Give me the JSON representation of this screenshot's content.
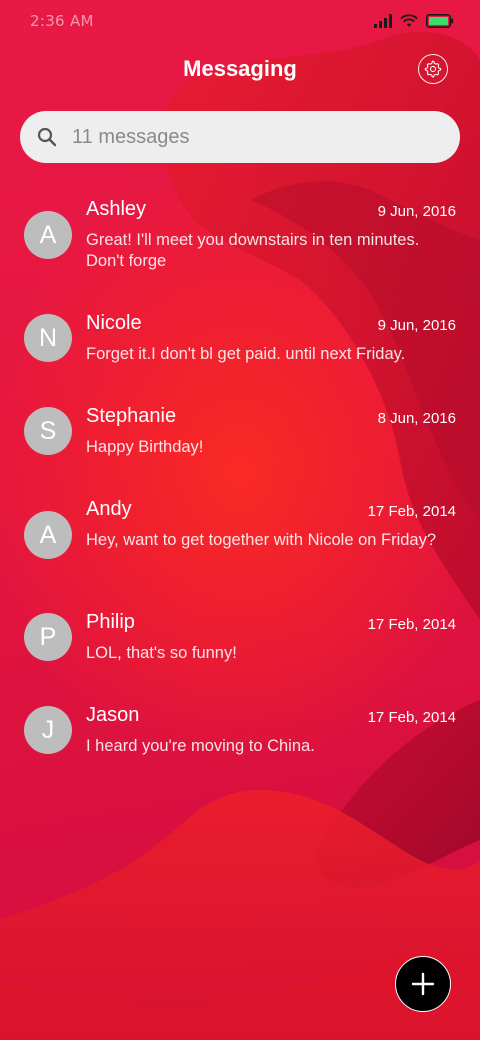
{
  "status_bar": {
    "time": "2:36 AM",
    "icons": [
      "signal-icon",
      "wifi-icon",
      "battery-icon"
    ]
  },
  "header": {
    "title": "Messaging",
    "settings_icon": "gear-icon"
  },
  "search": {
    "placeholder": "11 messages",
    "icon": "search-icon"
  },
  "messages": [
    {
      "initial": "A",
      "name": "Ashley",
      "date": "9 Jun, 2016",
      "preview": "Great! I'll meet you downstairs in ten minutes. Don't forge"
    },
    {
      "initial": "N",
      "name": "Nicole",
      "date": "9 Jun, 2016",
      "preview": "Forget it.I don't bl get paid. until next Friday."
    },
    {
      "initial": "S",
      "name": "Stephanie",
      "date": "8 Jun, 2016",
      "preview": "Happy Birthday!"
    },
    {
      "initial": "A",
      "name": "Andy",
      "date": "17 Feb, 2014",
      "preview": "Hey, want to get together with Nicole on Friday?"
    },
    {
      "initial": "P",
      "name": "Philip",
      "date": "17 Feb, 2014",
      "preview": "LOL, that's so funny!"
    },
    {
      "initial": "J",
      "name": "Jason",
      "date": "17 Feb, 2014",
      "preview": "I heard you're moving to China."
    }
  ],
  "fab": {
    "icon": "plus-icon"
  },
  "colors": {
    "background": "#e5163f",
    "avatar": "#bdbdbd",
    "search_bg": "#eeeeee",
    "fab": "#000000",
    "battery": "#3ddc6a"
  }
}
